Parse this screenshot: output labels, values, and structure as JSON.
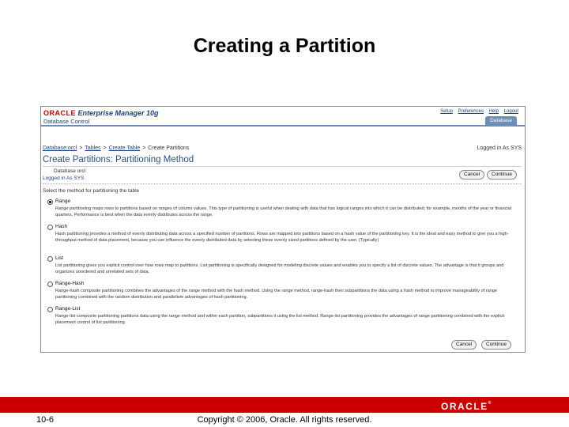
{
  "slide": {
    "title": "Creating a Partition",
    "page_number": "10-6",
    "copyright": "Copyright © 2006, Oracle. All rights reserved.",
    "footer_logo": "ORACLE"
  },
  "em": {
    "brand_oracle": "ORACLE",
    "brand_product": "Enterprise Manager 10g",
    "brand_sub": "Database Control",
    "top_links": [
      "Setup",
      "Preferences",
      "Help",
      "Logout"
    ],
    "tab": "Database"
  },
  "breadcrumb": {
    "items": [
      "Database:orcl",
      "Tables",
      "Create Table"
    ],
    "current": "Create Partitions",
    "separator": ">"
  },
  "logged_in_right": "Logged in As SYS",
  "page": {
    "heading": "Create Partitions: Partitioning Method",
    "database_line": "Database orcl",
    "logged_line": "Logged in As SYS",
    "select_label": "Select the method for partitioning the table"
  },
  "buttons": {
    "cancel": "Cancel",
    "continue": "Continue"
  },
  "options": [
    {
      "name": "Range",
      "selected": true,
      "desc": "Range partitioning maps rows to partitions based on ranges of column values. This type of partitioning is useful when dealing with data that has logical ranges into which it can be distributed; for example, months of the year or financial quarters. Performance is best when the data evenly distributes across the range."
    },
    {
      "name": "Hash",
      "selected": false,
      "desc": "Hash partitioning provides a method of evenly distributing data across a specified number of partitions. Rows are mapped into partitions based on a hash value of the partitioning key. It is the ideal and easy method to give you a high-throughput method of data placement, because you can influence the evenly distributed data by selecting these evenly sized partitions defined by the user. (Typically)"
    },
    {
      "name": "List",
      "selected": false,
      "desc": "List partitioning gives you explicit control over how rows map to partitions. List partitioning is specifically designed for modeling discrete values and enables you to specify a list of discrete values. The advantage is that it groups and organizes unordered and unrelated sets of data."
    },
    {
      "name": "Range-Hash",
      "selected": false,
      "desc": "Range-hash composite partitioning combines the advantages of the range method with the hash method. Using the range method, range-hash then subpartitions the data using a hash method to improve manageability of range partitioning combined with the random distribution and parallelism advantages of hash partitioning."
    },
    {
      "name": "Range-List",
      "selected": false,
      "desc": "Range-list composite partitioning partitions data using the range method and within each partition, subpartitions it using the list method. Range-list partitioning provides the advantages of range partitioning combined with the explicit placement control of list partitioning."
    }
  ]
}
